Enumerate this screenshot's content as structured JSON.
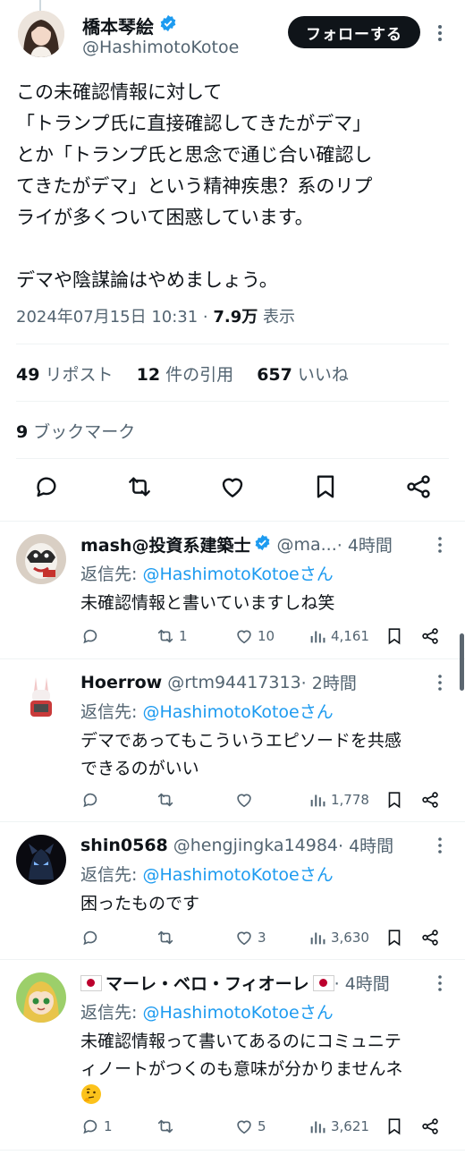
{
  "colors": {
    "accent": "#1d9bf0",
    "text": "#0f1419",
    "muted": "#536471",
    "follow_bg": "#0f1419"
  },
  "post": {
    "author_name": "橋本琴絵",
    "handle": "@HashimotoKotoe",
    "verified": true,
    "follow_label": "フォローする",
    "body": "この未確認情報に対して\n「トランプ氏に直接確認してきたがデマ」\nとか「トランプ氏と思念で通じ合い確認し\nてきたがデマ」という精神疾患？系のリプ\nライが多くついて困惑しています。\n\nデマや陰謀論はやめましょう。",
    "timestamp": "2024年07月15日 10:31 · ",
    "views_count": "7.9万",
    "views_label": " 表示",
    "reposts_count": "49",
    "reposts_label": " リポスト",
    "quotes_count": "12",
    "quotes_label": " 件の引用",
    "likes_count": "657",
    "likes_label": " いいね",
    "bookmarks_count": "9",
    "bookmarks_label": " ブックマーク",
    "icons": [
      "reply-icon",
      "repost-icon",
      "like-icon",
      "bookmark-icon",
      "share-icon"
    ]
  },
  "replies": [
    {
      "name": "mash@投資系建築士",
      "verified": true,
      "handle": "@ma...",
      "time": " · 4時間",
      "reply_to_label": "返信先: ",
      "reply_to_link": "@HashimotoKotoeさん",
      "text": "未確認情報と書いていますしね笑",
      "reply_count": "",
      "repost_count": "1",
      "like_count": "10",
      "view_count": "4,161"
    },
    {
      "name": "Hoerrow",
      "verified": false,
      "handle": "@rtm94417313",
      "time": " · 2時間",
      "reply_to_label": "返信先: ",
      "reply_to_link": "@HashimotoKotoeさん",
      "text": "デマであってもこういうエピソードを共感\nできるのがいい",
      "reply_count": "",
      "repost_count": "",
      "like_count": "",
      "view_count": "1,778"
    },
    {
      "name": "shin0568",
      "verified": false,
      "handle": "@hengjingka14984",
      "time": " · 4時間",
      "reply_to_label": "返信先: ",
      "reply_to_link": "@HashimotoKotoeさん",
      "text": "困ったものです",
      "reply_count": "",
      "repost_count": "",
      "like_count": "3",
      "view_count": "3,630"
    },
    {
      "name": "マーレ・ベロ・フィオーレ",
      "verified": false,
      "handle": "",
      "time": " · 4時間",
      "reply_to_label": "返信先: ",
      "reply_to_link": "@HashimotoKotoeさん",
      "text": "未確認情報って書いてあるのにコミュニテ\nィノートがつくのも意味が分かりませんネ",
      "emoji": "thinking-face",
      "reply_count": "1",
      "repost_count": "",
      "like_count": "5",
      "view_count": "3,621"
    }
  ]
}
